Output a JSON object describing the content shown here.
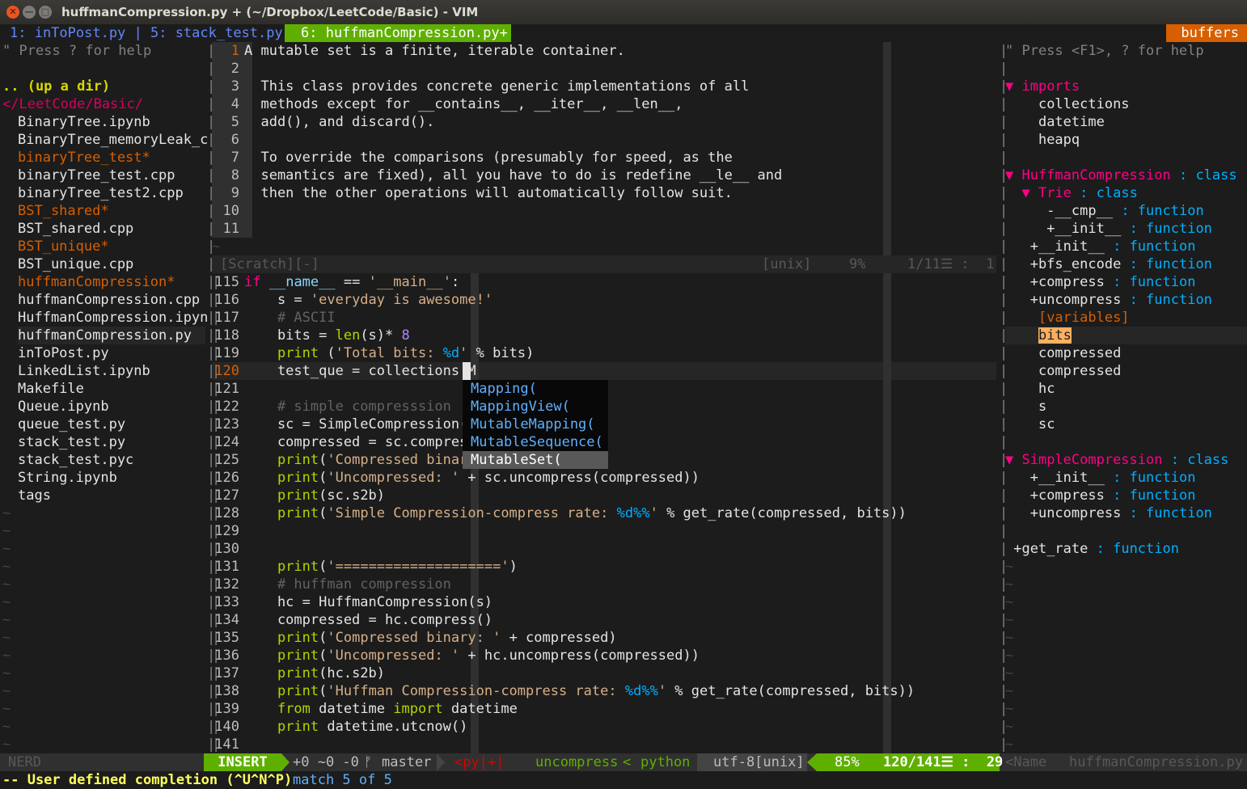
{
  "window": {
    "title": "huffmanCompression.py + (~/Dropbox/LeetCode/Basic) - VIM"
  },
  "tabline": {
    "tab1": "1: inToPost.py | 5: stack_test.py",
    "tab_active": "6: huffmanCompression.py+",
    "buffers_label": "buffers"
  },
  "nerdtree": {
    "help": "\" Press ? for help",
    "updir": ".. (up a dir)",
    "root": "</LeetCode/Basic/",
    "files": [
      {
        "name": "BinaryTree.ipynb"
      },
      {
        "name": "BinaryTree_memoryLeak_c"
      },
      {
        "name": "binaryTree_test*"
      },
      {
        "name": "binaryTree_test.cpp"
      },
      {
        "name": "binaryTree_test2.cpp"
      },
      {
        "name": "BST_shared*"
      },
      {
        "name": "BST_shared.cpp"
      },
      {
        "name": "BST_unique*"
      },
      {
        "name": "BST_unique.cpp"
      },
      {
        "name": "huffmanCompression*"
      },
      {
        "name": "huffmanCompression.cpp"
      },
      {
        "name": "HuffmanCompression.ipyn"
      },
      {
        "name": "huffmanCompression.py"
      },
      {
        "name": "inToPost.py"
      },
      {
        "name": "LinkedList.ipynb"
      },
      {
        "name": "Makefile"
      },
      {
        "name": "Queue.ipynb"
      },
      {
        "name": "queue_test.py"
      },
      {
        "name": "stack_test.py"
      },
      {
        "name": "stack_test.pyc"
      },
      {
        "name": "String.ipynb"
      },
      {
        "name": "tags"
      }
    ],
    "status": "NERD"
  },
  "scratch": {
    "lines": [
      {
        "n": "1",
        "text": "A mutable set is a finite, iterable container."
      },
      {
        "n": "2",
        "text": ""
      },
      {
        "n": "3",
        "text": "  This class provides concrete generic implementations of all"
      },
      {
        "n": "4",
        "text": "  methods except for __contains__, __iter__, __len__,"
      },
      {
        "n": "5",
        "text": "  add(), and discard()."
      },
      {
        "n": "6",
        "text": ""
      },
      {
        "n": "7",
        "text": "  To override the comparisons (presumably for speed, as the"
      },
      {
        "n": "8",
        "text": "  semantics are fixed), all you have to do is redefine __le__ and"
      },
      {
        "n": "9",
        "text": "  then the other operations will automatically follow suit."
      },
      {
        "n": "10",
        "text": ""
      },
      {
        "n": "11",
        "text": ""
      }
    ],
    "status_name": "[Scratch][-]",
    "status_ff": "[unix]",
    "status_pct": "9%",
    "status_pos": "1/11☰ :  1"
  },
  "code": {
    "lines": [
      {
        "n": "115",
        "t": "if __name__ == '__main__':"
      },
      {
        "n": "116",
        "t": "    s = 'everyday is awesome!'"
      },
      {
        "n": "117",
        "t": "    # ASCII"
      },
      {
        "n": "118",
        "t": "    bits = len(s)* 8"
      },
      {
        "n": "119",
        "t": "    print ('Total bits: %d' % bits)"
      },
      {
        "n": "120",
        "t": "    test_que = collections.M"
      },
      {
        "n": "121",
        "t": ""
      },
      {
        "n": "122",
        "t": "    # simple compresssion"
      },
      {
        "n": "123",
        "t": "    sc = SimpleCompression("
      },
      {
        "n": "124",
        "t": "    compressed = sc.compres"
      },
      {
        "n": "125",
        "t": "    print('Compressed binar"
      },
      {
        "n": "126",
        "t": "    print('Uncompressed: ' + sc.uncompress(compressed))"
      },
      {
        "n": "127",
        "t": "    print(sc.s2b)"
      },
      {
        "n": "128",
        "t": "    print('Simple Compression-compress rate: %d%%' % get_rate(compressed, bits))"
      },
      {
        "n": "129",
        "t": ""
      },
      {
        "n": "130",
        "t": ""
      },
      {
        "n": "131",
        "t": "    print('====================')"
      },
      {
        "n": "132",
        "t": "    # huffman compression"
      },
      {
        "n": "133",
        "t": "    hc = HuffmanCompression(s)"
      },
      {
        "n": "134",
        "t": "    compressed = hc.compress()"
      },
      {
        "n": "135",
        "t": "    print('Compressed binary: ' + compressed)"
      },
      {
        "n": "136",
        "t": "    print('Uncompressed: ' + hc.uncompress(compressed))"
      },
      {
        "n": "137",
        "t": "    print(hc.s2b)"
      },
      {
        "n": "138",
        "t": "    print('Huffman Compression-compress rate: %d%%' % get_rate(compressed, bits))"
      },
      {
        "n": "139",
        "t": "    from datetime import datetime"
      },
      {
        "n": "140",
        "t": "    print datetime.utcnow()"
      },
      {
        "n": "141",
        "t": ""
      }
    ]
  },
  "completion": {
    "items": [
      "Mapping(",
      "MappingView(",
      "MutableMapping(",
      "MutableSequence(",
      "MutableSet("
    ],
    "selected": 4
  },
  "tagbar": {
    "help": "\" Press <F1>, ? for help",
    "imports_label": "imports",
    "imports": [
      "collections",
      "datetime",
      "heapq"
    ],
    "huffman": {
      "name": "HuffmanCompression",
      "kind": ": class"
    },
    "trie": {
      "name": "Trie",
      "kind": ": class"
    },
    "trie_members": [
      {
        "name": "-__cmp__",
        "kind": ": function"
      },
      {
        "name": "+__init__",
        "kind": ": function"
      }
    ],
    "huffman_members": [
      {
        "name": "+__init__",
        "kind": ": function"
      },
      {
        "name": "+bfs_encode",
        "kind": ": function"
      },
      {
        "name": "+compress",
        "kind": ": function"
      },
      {
        "name": "+uncompress",
        "kind": ": function"
      }
    ],
    "variables_label": "[variables]",
    "variables": [
      "bits",
      "compressed",
      "compressed",
      "hc",
      "s",
      "sc"
    ],
    "simple": {
      "name": "SimpleCompression",
      "kind": ": class"
    },
    "simple_members": [
      {
        "name": "+__init__",
        "kind": ": function"
      },
      {
        "name": "+compress",
        "kind": ": function"
      },
      {
        "name": "+uncompress",
        "kind": ": function"
      }
    ],
    "get_rate": {
      "name": "+get_rate",
      "kind": ": function"
    },
    "status_left": "<Name",
    "status_file": "huffmanCompression.py"
  },
  "statusline": {
    "mode": "INSERT",
    "git": "+0 ~0 -0",
    "branch_icon": "branch-icon",
    "branch": "master",
    "syntax_err": "<py|+|",
    "func": "uncompress",
    "filetype": "python",
    "enc": "utf-8[unix]",
    "pct": "85%",
    "pos": "120/141☰ :  29"
  },
  "cmdline": {
    "text": "-- User defined completion (^U^N^P)",
    "match": "match 5 of 5"
  },
  "colors": {
    "accent": "#5faf00",
    "insert": "#5f8700",
    "tag": "#e95420"
  }
}
